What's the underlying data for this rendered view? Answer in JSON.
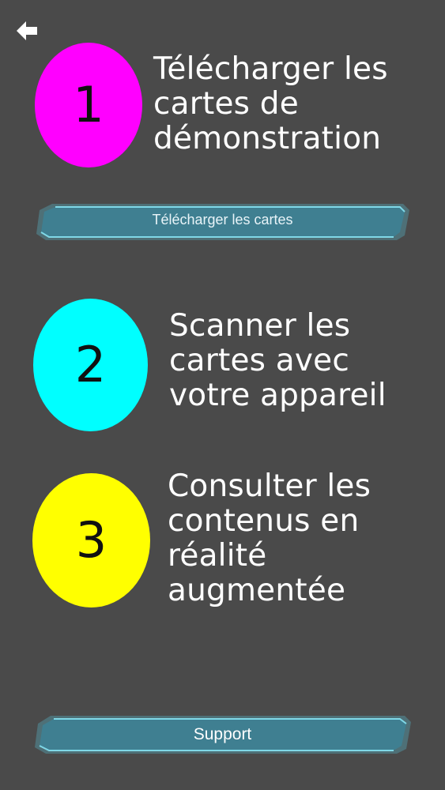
{
  "header": {
    "back_icon": "arrow-left-icon"
  },
  "steps": [
    {
      "number": "1",
      "text": "Télécharger les cartes de démonstration",
      "color": "#ff00ff"
    },
    {
      "number": "2",
      "text": "Scanner les cartes avec votre appareil",
      "color": "#00ffff"
    },
    {
      "number": "3",
      "text": "Consulter les contenus en réalité augmentée",
      "color": "#ffff00"
    }
  ],
  "buttons": {
    "download_label": "Télécharger les cartes",
    "support_label": "Support"
  },
  "colors": {
    "background": "#4a4a4a",
    "button_fill": "#3f7f91",
    "button_glow": "#58d6ee"
  }
}
